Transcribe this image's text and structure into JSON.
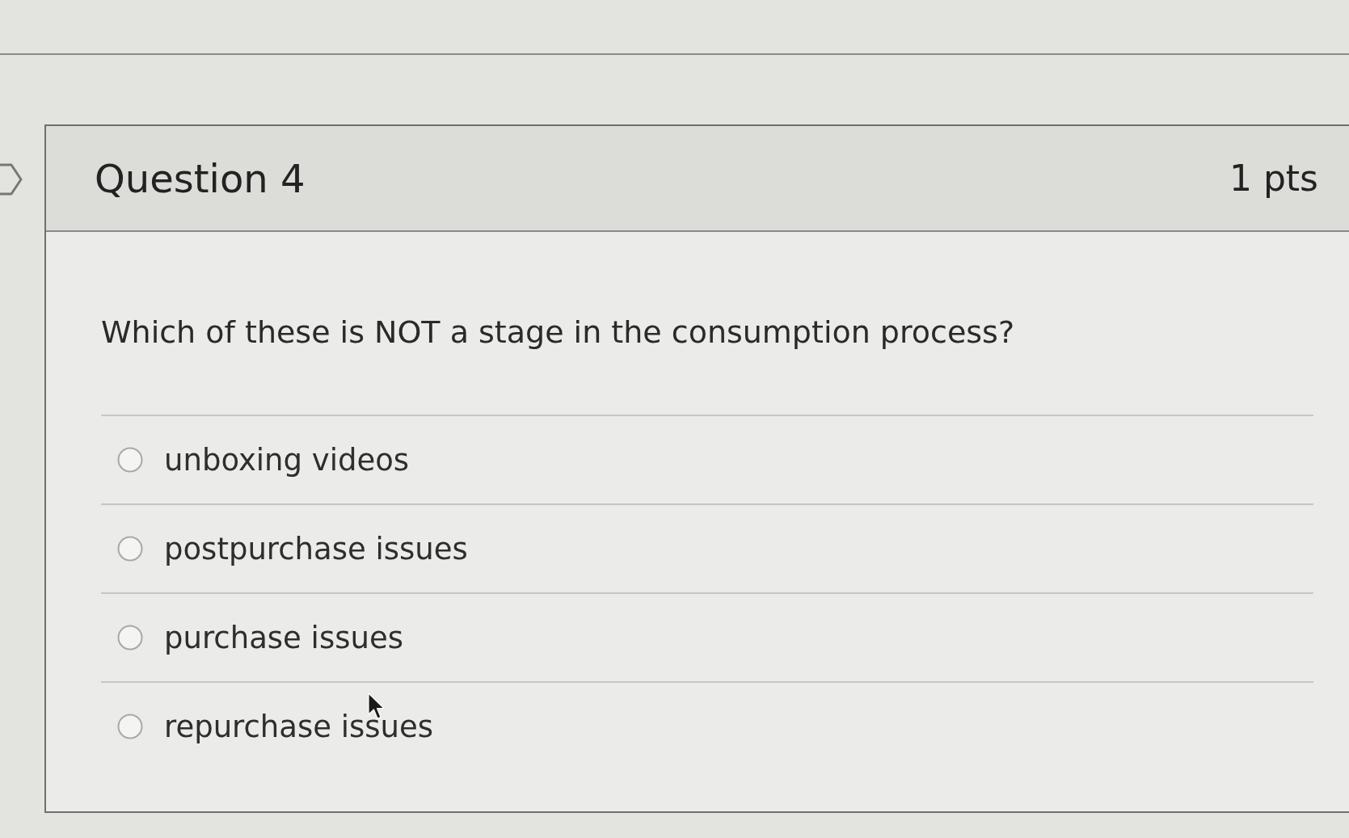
{
  "question": {
    "title": "Question 4",
    "points": "1 pts",
    "prompt": "Which of these is NOT a stage in the consumption process?",
    "options": [
      {
        "label": "unboxing videos",
        "selected": false
      },
      {
        "label": "postpurchase issues",
        "selected": false
      },
      {
        "label": "purchase issues",
        "selected": false
      },
      {
        "label": "repurchase issues",
        "selected": false
      }
    ]
  }
}
